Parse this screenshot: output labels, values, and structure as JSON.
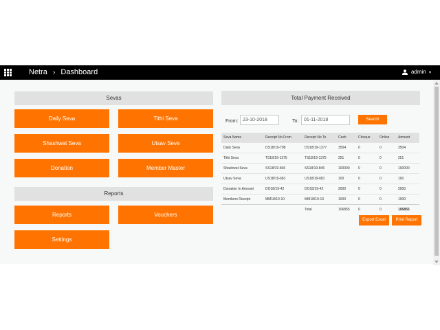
{
  "navbar": {
    "menu_icon": "apps-grid-icon",
    "brand": "Netra",
    "separator": "›",
    "page": "Dashboard",
    "user_icon": "user-icon",
    "user_label": "admin",
    "caret": "▾"
  },
  "sevas": {
    "title": "Sevas",
    "buttons": [
      "Daily Seva",
      "Tithi Seva",
      "Shashwat Seva",
      "Utsav Seva",
      "Donation",
      "Member Master"
    ]
  },
  "reports": {
    "title": "Reports",
    "buttons": [
      "Reports",
      "Vouchers",
      "Settings"
    ]
  },
  "payment": {
    "title": "Total Payment Received",
    "from_label": "From:",
    "from_value": "23-10-2018",
    "to_label": "To:",
    "to_value": "01-11-2018",
    "search_label": "Search",
    "columns": [
      "Seva Name",
      "Receipt No From",
      "Receipt No To",
      "Cash",
      "Cheque",
      "Online",
      "Amount"
    ],
    "rows": [
      [
        "Daily Seva",
        "DS18/19-798",
        "DS18/19-1377",
        "3504",
        "0",
        "0",
        "3504"
      ],
      [
        "Tithi Seva",
        "TS18/19-1375",
        "TS18/19-1375",
        "251",
        "0",
        "0",
        "251"
      ],
      [
        "Shashwat Seva",
        "SS18/19-846",
        "SS18/19-846",
        "100000",
        "0",
        "0",
        "100000"
      ],
      [
        "Utsav Seva",
        "US18/19-681",
        "US18/19-681",
        "100",
        "0",
        "0",
        "100"
      ],
      [
        "Donation In Amount",
        "DO18/19-42",
        "DO18/19-42",
        "2000",
        "0",
        "0",
        "2000"
      ],
      [
        "Members Receipt",
        "MM18/19-10",
        "MM18/19-10",
        "1000",
        "0",
        "0",
        "1000"
      ]
    ],
    "total": [
      "",
      "",
      "Total",
      "106855",
      "0",
      "0",
      "106855"
    ],
    "export_label": "Export Excel",
    "print_label": "Print Report"
  },
  "colors": {
    "accent": "#ff7400",
    "navbar": "#000000",
    "section_header": "#e1e1e1",
    "background": "#f7f8f8"
  }
}
